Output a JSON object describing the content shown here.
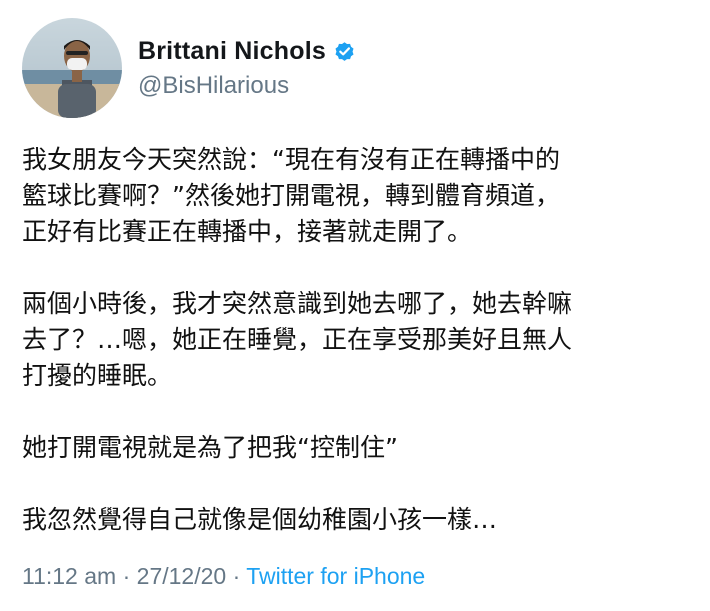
{
  "author": {
    "display_name": "Brittani Nichols",
    "handle": "@BisHilarious",
    "verified": true,
    "avatar": "avatar-photo-person-at-beach"
  },
  "tweet": {
    "paragraphs": [
      [
        "我女朋友今天突然說：“現在有沒有正在轉播中的",
        "籃球比賽啊？”然後她打開電視，轉到體育頻道，",
        "正好有比賽正在轉播中，接著就走開了。"
      ],
      [
        "兩個小時後，我才突然意識到她去哪了，她去幹嘛",
        "去了？…嗯，她正在睡覺，正在享受那美好且無人",
        "打擾的睡眠。"
      ],
      [
        "她打開電視就是為了把我“控制住”"
      ],
      [
        "我忽然覺得自己就像是個幼稚園小孩一樣…"
      ]
    ]
  },
  "meta": {
    "time": "11:12 am",
    "date": "27/12/20",
    "separator": "·",
    "source": "Twitter for iPhone"
  },
  "colors": {
    "name": "#14171a",
    "handle": "#657786",
    "link": "#1da1f2",
    "verified_badge": "#1da1f2"
  }
}
